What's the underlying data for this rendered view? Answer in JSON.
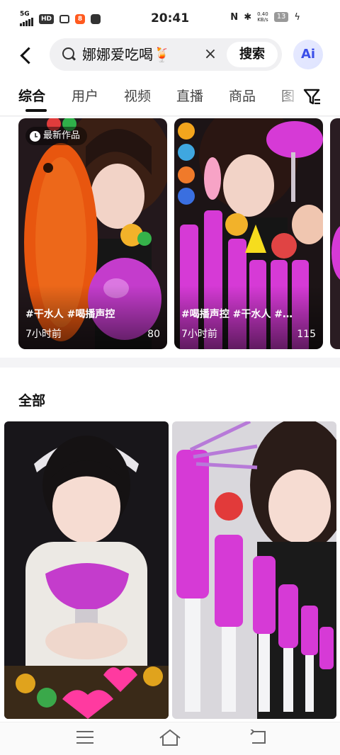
{
  "status_bar": {
    "network": "5G",
    "hd_label": "HD",
    "time": "20:41",
    "speed_value": "0.40",
    "speed_unit": "KB/s",
    "battery": "13"
  },
  "search": {
    "query": "娜娜爱吃喝🍹",
    "clear_symbol": "×",
    "submit_label": "搜索",
    "ai_label": "Ai"
  },
  "tabs": [
    {
      "label": "综合"
    },
    {
      "label": "用户"
    },
    {
      "label": "视频"
    },
    {
      "label": "直播"
    },
    {
      "label": "商品"
    },
    {
      "label": "图"
    }
  ],
  "top_cards": [
    {
      "badge": "最新作品",
      "tags": "#干水人 #喝播声控",
      "time": "7小时前",
      "count": "80"
    },
    {
      "badge": "",
      "tags": "#喝播声控 #干水人 #…",
      "time": "7小时前",
      "count": "115"
    }
  ],
  "section_all": {
    "title": "全部"
  },
  "icons": {
    "back": "back-arrow-icon",
    "search": "search-icon",
    "filter": "filter-icon",
    "clock": "clock-icon",
    "nav_menu": "menu-icon",
    "nav_home": "home-icon",
    "nav_back": "back-icon"
  },
  "colors": {
    "accent_ai": "#3a4ee8",
    "magenta": "#d63ad6",
    "orange": "#e8560f"
  }
}
